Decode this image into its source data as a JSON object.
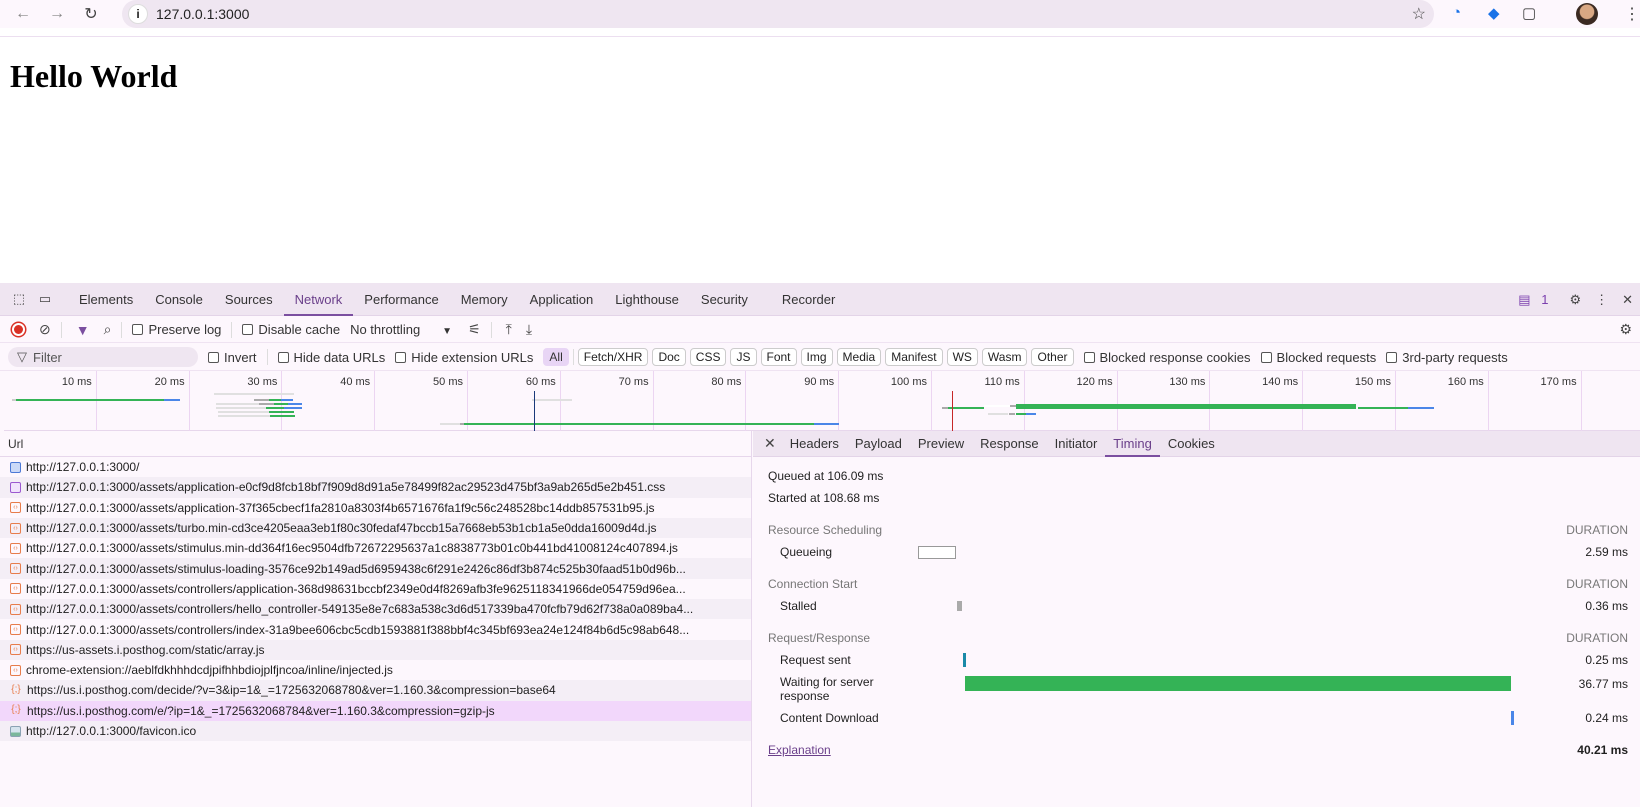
{
  "browser": {
    "url": "127.0.0.1:3000",
    "icons": [
      "back-arrow-icon",
      "forward-arrow-icon",
      "reload-icon",
      "site-info-icon",
      "bookmark-star-icon",
      "extension-1password-icon",
      "extension-tag-icon",
      "extensions-puzzle-icon",
      "profile-avatar",
      "menu-kebab-icon"
    ]
  },
  "page": {
    "heading": "Hello World"
  },
  "devtools": {
    "tabs": [
      "Elements",
      "Console",
      "Sources",
      "Network",
      "Performance",
      "Memory",
      "Application",
      "Lighthouse",
      "Security",
      "Recorder"
    ],
    "active_tab": "Network",
    "issues_count": "1",
    "toolbar": {
      "preserve_log": "Preserve log",
      "disable_cache": "Disable cache",
      "throttling": "No throttling"
    },
    "filterbar": {
      "filter_placeholder": "Filter",
      "invert": "Invert",
      "hide_data_urls": "Hide data URLs",
      "hide_extension_urls": "Hide extension URLs",
      "types": [
        "All",
        "Fetch/XHR",
        "Doc",
        "CSS",
        "JS",
        "Font",
        "Img",
        "Media",
        "Manifest",
        "WS",
        "Wasm",
        "Other"
      ],
      "blocked_response_cookies": "Blocked response cookies",
      "blocked_requests": "Blocked requests",
      "third_party": "3rd-party requests"
    },
    "overview": {
      "ticks": [
        "10 ms",
        "20 ms",
        "30 ms",
        "40 ms",
        "50 ms",
        "60 ms",
        "70 ms",
        "80 ms",
        "90 ms",
        "100 ms",
        "110 ms",
        "120 ms",
        "130 ms",
        "140 ms",
        "150 ms",
        "160 ms",
        "170 ms"
      ]
    },
    "requests": {
      "column": "Url",
      "rows": [
        {
          "type": "doc",
          "url": "http://127.0.0.1:3000/"
        },
        {
          "type": "css",
          "url": "http://127.0.0.1:3000/assets/application-e0cf9d8fcb18bf7f909d8d91a5e78499f82ac29523d475bf3a9ab265d5e2b451.css"
        },
        {
          "type": "js",
          "url": "http://127.0.0.1:3000/assets/application-37f365cbecf1fa2810a8303f4b6571676fa1f9c56c248528bc14ddb857531b95.js"
        },
        {
          "type": "js",
          "url": "http://127.0.0.1:3000/assets/turbo.min-cd3ce4205eaa3eb1f80c30fedaf47bccb15a7668eb53b1cb1a5e0dda16009d4d.js"
        },
        {
          "type": "js",
          "url": "http://127.0.0.1:3000/assets/stimulus.min-dd364f16ec9504dfb72672295637a1c8838773b01c0b441bd41008124c407894.js"
        },
        {
          "type": "js",
          "url": "http://127.0.0.1:3000/assets/stimulus-loading-3576ce92b149ad5d6959438c6f291e2426c86df3b874c525b30faad51b0d96b..."
        },
        {
          "type": "js",
          "url": "http://127.0.0.1:3000/assets/controllers/application-368d98631bccbf2349e0d4f8269afb3fe9625118341966de054759d96ea..."
        },
        {
          "type": "js",
          "url": "http://127.0.0.1:3000/assets/controllers/hello_controller-549135e8e7c683a538c3d6d517339ba470fcfb79d62f738a0a089ba4..."
        },
        {
          "type": "js",
          "url": "http://127.0.0.1:3000/assets/controllers/index-31a9bee606cbc5cdb1593881f388bbf4c345bf693ea24e124f84b6d5c98ab648..."
        },
        {
          "type": "js",
          "url": "https://us-assets.i.posthog.com/static/array.js"
        },
        {
          "type": "js",
          "url": "chrome-extension://aeblfdkhhhdcdjpifhhbdiojplfjncoa/inline/injected.js"
        },
        {
          "type": "xhr",
          "url": "https://us.i.posthog.com/decide/?v=3&ip=1&_=1725632068780&ver=1.160.3&compression=base64"
        },
        {
          "type": "xhr",
          "url": "https://us.i.posthog.com/e/?ip=1&_=1725632068784&ver=1.160.3&compression=gzip-js",
          "selected": true
        },
        {
          "type": "img",
          "url": "http://127.0.0.1:3000/favicon.ico"
        }
      ]
    },
    "detail": {
      "tabs": [
        "Headers",
        "Payload",
        "Preview",
        "Response",
        "Initiator",
        "Timing",
        "Cookies"
      ],
      "active_tab": "Timing",
      "queued_at": "Queued at 106.09 ms",
      "started_at": "Started at 108.68 ms",
      "duration_label": "DURATION",
      "sections": {
        "scheduling": "Resource Scheduling",
        "connection": "Connection Start",
        "request": "Request/Response"
      },
      "rows": {
        "queueing": {
          "label": "Queueing",
          "value": "2.59 ms"
        },
        "stalled": {
          "label": "Stalled",
          "value": "0.36 ms"
        },
        "request_sent": {
          "label": "Request sent",
          "value": "0.25 ms"
        },
        "waiting": {
          "label": "Waiting for server response",
          "value": "36.77 ms"
        },
        "download": {
          "label": "Content Download",
          "value": "0.24 ms"
        }
      },
      "explanation": "Explanation",
      "total": "40.21 ms"
    }
  }
}
